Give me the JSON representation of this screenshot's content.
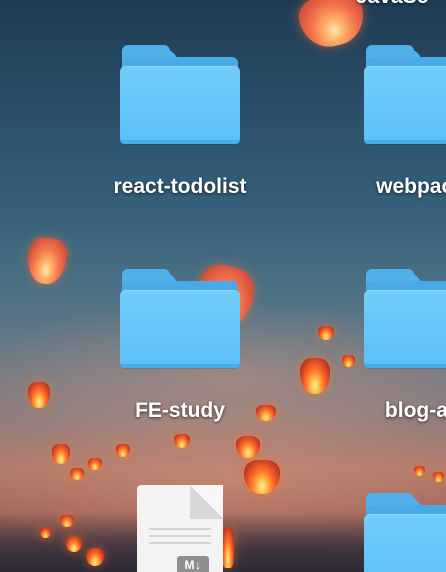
{
  "desktop": {
    "wallpaper": "sky lanterns at dusk",
    "items": [
      {
        "label": "react-todolist",
        "type": "folder",
        "icon": "folder-icon"
      },
      {
        "label": "webpack-",
        "type": "folder",
        "icon": "folder-icon"
      },
      {
        "label": "FE-study",
        "type": "folder",
        "icon": "folder-icon"
      },
      {
        "label": "blog-art",
        "type": "folder",
        "icon": "folder-icon"
      },
      {
        "label": "",
        "type": "folder",
        "icon": "folder-icon"
      },
      {
        "label": "",
        "type": "markdown-file",
        "icon": "markdown-file-icon",
        "badge": "M↓"
      }
    ],
    "top_clipped_label": "JavaSc"
  },
  "colors": {
    "folder_front": "#5bc0f7",
    "folder_back": "#4aaae6",
    "label_text": "#ffffff"
  }
}
